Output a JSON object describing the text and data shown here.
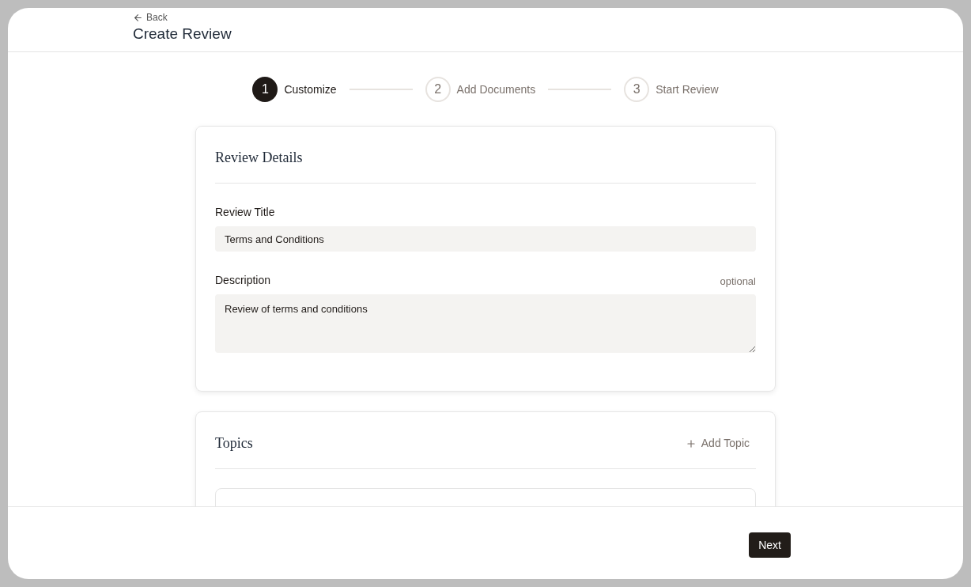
{
  "header": {
    "back": "Back",
    "title": "Create Review"
  },
  "steps": [
    {
      "number": "1",
      "label": "Customize",
      "selected": true
    },
    {
      "number": "2",
      "label": "Add Documents",
      "selected": false
    },
    {
      "number": "3",
      "label": "Start Review",
      "selected": false
    }
  ],
  "details": {
    "heading": "Review Details",
    "fields": [
      {
        "label": "Review Title",
        "value": "Terms and Conditions",
        "kind": "input"
      },
      {
        "label": "Description",
        "hint": "optional",
        "value": "Review of terms and conditions",
        "kind": "textarea"
      }
    ]
  },
  "topics": {
    "heading": "Topics",
    "add": "Add Topic"
  },
  "footer": {
    "next": "Next"
  }
}
